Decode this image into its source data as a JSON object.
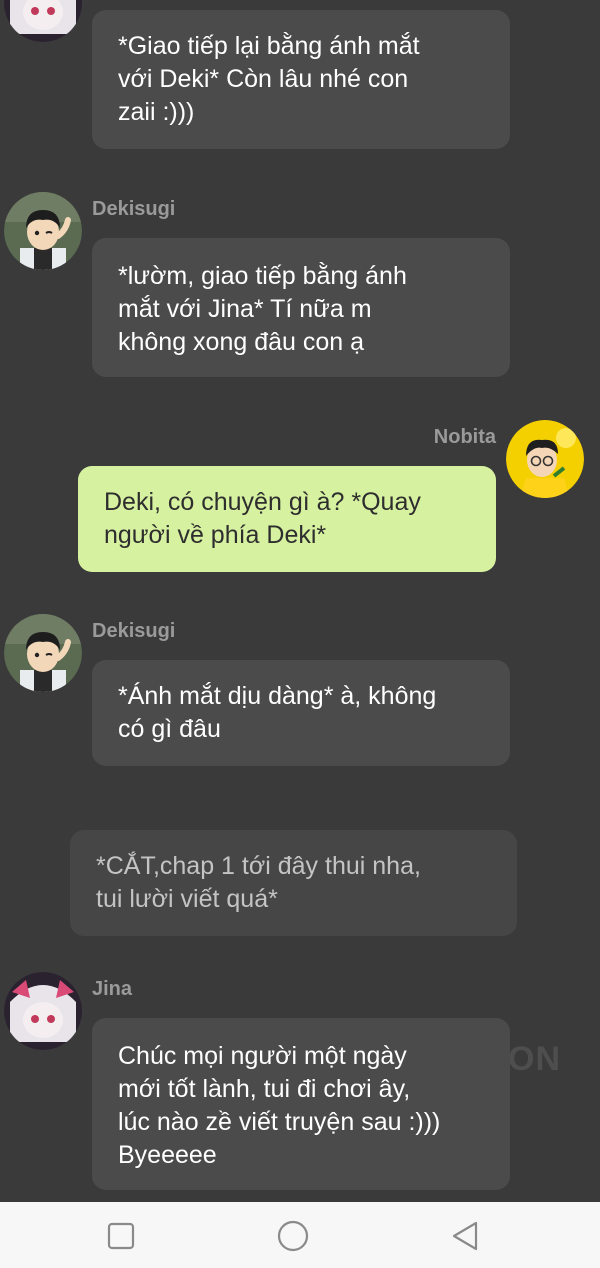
{
  "messages": [
    {
      "sender": "",
      "lines": [
        "*Giao tiếp lại bằng ánh mắt",
        "với Deki* Còn lâu nhé con",
        "zaii :)))"
      ]
    },
    {
      "sender": "Dekisugi",
      "lines": [
        "*lườm, giao tiếp bằng ánh",
        "mắt với Jina* Tí nữa m",
        "không xong đâu con ạ"
      ]
    },
    {
      "sender": "Nobita",
      "lines": [
        "Deki, có chuyện gì à? *Quay",
        "người về phía Deki*"
      ]
    },
    {
      "sender": "Dekisugi",
      "lines": [
        "*Ánh mắt dịu dàng* à, không",
        "có gì đâu"
      ]
    },
    {
      "sender": "",
      "lines": [
        "*CẮT,chap 1 tới đây thui nha,",
        "tui lười viết quá*"
      ]
    },
    {
      "sender": "Jina",
      "lines": [
        "Chúc mọi người một ngày",
        "mới tốt lành, tui đi chơi ây,",
        "lúc nào zề viết truyện sau :)))",
        "Byeeeee"
      ]
    }
  ],
  "watermark": "ON",
  "navbar": {
    "square_icon": "square-icon",
    "circle_icon": "circle-icon",
    "back_icon": "triangle-back-icon"
  },
  "colors": {
    "background": "#3a3a3a",
    "bubble": "#4b4b4b",
    "bubble_green": "#d6f1a0",
    "narration": "#464646",
    "navbar": "#f7f7f7"
  }
}
